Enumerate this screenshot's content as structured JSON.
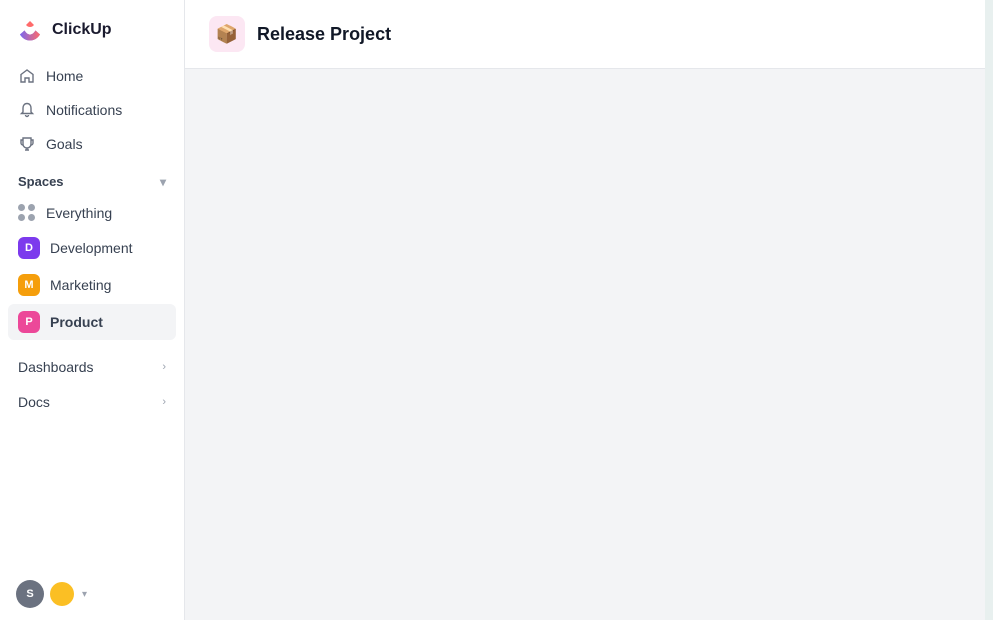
{
  "app": {
    "name": "ClickUp"
  },
  "sidebar": {
    "nav": [
      {
        "id": "home",
        "label": "Home",
        "icon": "home-icon"
      },
      {
        "id": "notifications",
        "label": "Notifications",
        "icon": "bell-icon"
      },
      {
        "id": "goals",
        "label": "Goals",
        "icon": "trophy-icon"
      }
    ],
    "spaces_section": "Spaces",
    "spaces": [
      {
        "id": "everything",
        "label": "Everything",
        "type": "dots"
      },
      {
        "id": "development",
        "label": "Development",
        "badge": "D",
        "badgeClass": "badge-d"
      },
      {
        "id": "marketing",
        "label": "Marketing",
        "badge": "M",
        "badgeClass": "badge-m"
      },
      {
        "id": "product",
        "label": "Product",
        "badge": "P",
        "badgeClass": "badge-p",
        "active": true
      }
    ],
    "expandable": [
      {
        "id": "dashboards",
        "label": "Dashboards"
      },
      {
        "id": "docs",
        "label": "Docs"
      }
    ]
  },
  "main": {
    "project_title": "Release Project"
  }
}
